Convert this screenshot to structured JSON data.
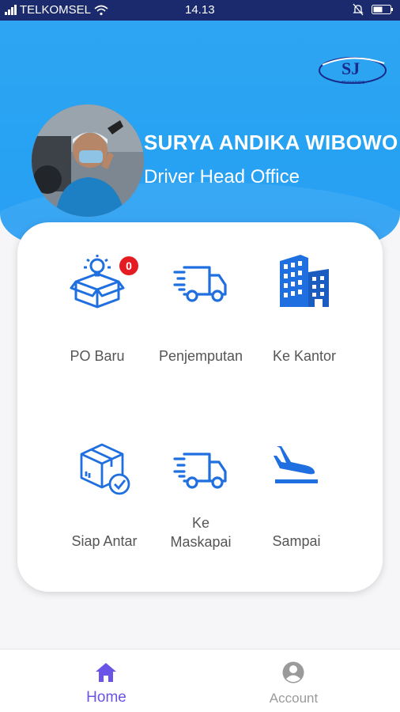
{
  "status_bar": {
    "carrier": "TELKOMSEL",
    "time": "14.13"
  },
  "profile": {
    "name": "SURYA ANDIKA WIBOWO",
    "role": "Driver Head Office"
  },
  "menu": [
    {
      "label": "PO Baru",
      "icon": "lightbulb-box-icon",
      "badge": "0"
    },
    {
      "label": "Penjemputan",
      "icon": "delivery-truck-icon"
    },
    {
      "label": "Ke Kantor",
      "icon": "office-building-icon"
    },
    {
      "label": "Siap Antar",
      "icon": "package-check-icon"
    },
    {
      "label": "Ke\nMaskapai",
      "icon": "delivery-truck-icon"
    },
    {
      "label": "Sampai",
      "icon": "plane-landing-icon"
    }
  ],
  "bottom_nav": [
    {
      "label": "Home",
      "icon": "home-icon",
      "active": true
    },
    {
      "label": "Account",
      "icon": "account-icon",
      "active": false
    }
  ],
  "colors": {
    "header": "#2ea5f2",
    "icon_blue": "#1f6fe0",
    "nav_active": "#6a54e8",
    "nav_inactive": "#9a9a9a",
    "badge": "#e51b23"
  }
}
